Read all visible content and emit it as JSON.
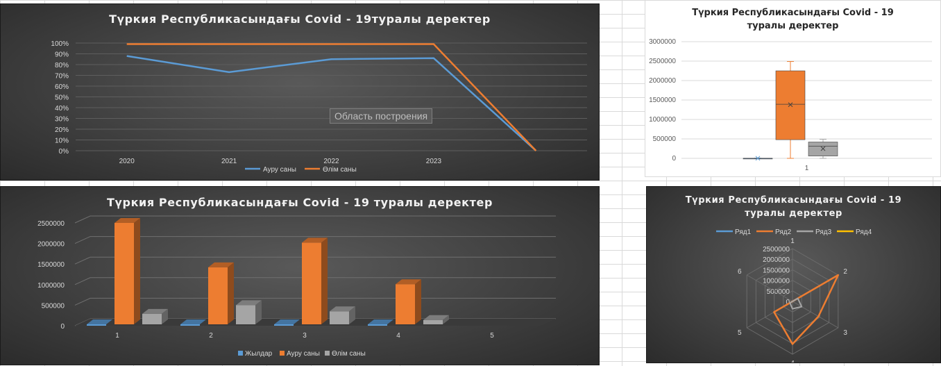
{
  "chart_data": [
    {
      "type": "line",
      "title": "Түркия Республикасындағы Covid - 19туралы деректер",
      "categories": [
        "2020",
        "2021",
        "2022",
        "2023",
        ""
      ],
      "ytick_labels": [
        "0%",
        "10%",
        "20%",
        "30%",
        "40%",
        "50%",
        "60%",
        "70%",
        "80%",
        "90%",
        "100%"
      ],
      "ylim": [
        0,
        100
      ],
      "series": [
        {
          "name": "Ауру саны",
          "color": "#5b9bd5",
          "values": [
            88,
            73,
            85,
            86,
            0
          ]
        },
        {
          "name": "Өлім саны",
          "color": "#ed7d31",
          "values": [
            99,
            99,
            99,
            99,
            0
          ]
        }
      ],
      "legend": "bottom",
      "tooltip": "Область построения"
    },
    {
      "type": "box",
      "title": "Түркия Республикасындағы Covid - 19 туралы деректер",
      "categories": [
        "1"
      ],
      "ytick_labels": [
        "0",
        "500000",
        "1000000",
        "1500000",
        "2000000",
        "2500000",
        "3000000"
      ],
      "ylim": [
        0,
        3000000
      ],
      "series": [
        {
          "color": "#5b9bd5",
          "min": 2020,
          "q1": 2020,
          "median": 2021,
          "q3": 2022,
          "max": 2023,
          "mean": 2021.5
        },
        {
          "color": "#ed7d31",
          "min": 0,
          "q1": 480000,
          "median": 1390000,
          "q3": 2250000,
          "max": 2490000,
          "mean": 1380000
        },
        {
          "color": "#a5a5a5",
          "min": 0,
          "q1": 60000,
          "median": 310000,
          "q3": 420000,
          "max": 490000,
          "mean": 250000
        }
      ]
    },
    {
      "type": "bar",
      "title": "Түркия Республикасындағы Covid - 19 туралы деректер",
      "categories": [
        "1",
        "2",
        "3",
        "4",
        "5"
      ],
      "ytick_labels": [
        "0",
        "500000",
        "1000000",
        "1500000",
        "2000000",
        "2500000"
      ],
      "ylim": [
        0,
        2500000
      ],
      "series": [
        {
          "name": "Жылдар",
          "color": "#5b9bd5",
          "values": [
            2020,
            2021,
            2022,
            2023,
            0
          ]
        },
        {
          "name": "Ауру саны",
          "color": "#ed7d31",
          "values": [
            2500000,
            1420000,
            2020000,
            1010000,
            0
          ]
        },
        {
          "name": "Өлім саны",
          "color": "#a5a5a5",
          "values": [
            290000,
            500000,
            350000,
            140000,
            0
          ]
        }
      ],
      "legend": "bottom"
    },
    {
      "type": "radar",
      "title": "Түркия Республикасындағы Covid - 19 туралы деректер",
      "axes": [
        "1",
        "2",
        "3",
        "4",
        "5",
        "6"
      ],
      "ytick_labels": [
        "0",
        "500000",
        "1000000",
        "1500000",
        "2000000",
        "2500000"
      ],
      "rlim": [
        0,
        2500000
      ],
      "series": [
        {
          "name": "Ряд1",
          "color": "#5b9bd5",
          "values": [
            2020,
            2021,
            2022,
            2023,
            0,
            0
          ]
        },
        {
          "name": "Ряд2",
          "color": "#ed7d31",
          "values": [
            0,
            2500000,
            1420000,
            2020000,
            1010000,
            0
          ]
        },
        {
          "name": "Ряд3",
          "color": "#a5a5a5",
          "values": [
            0,
            290000,
            500000,
            350000,
            140000,
            0
          ]
        },
        {
          "name": "Ряд4",
          "color": "#ffc000",
          "values": [
            0,
            0,
            0,
            0,
            0,
            0
          ]
        }
      ],
      "legend": "top"
    }
  ]
}
